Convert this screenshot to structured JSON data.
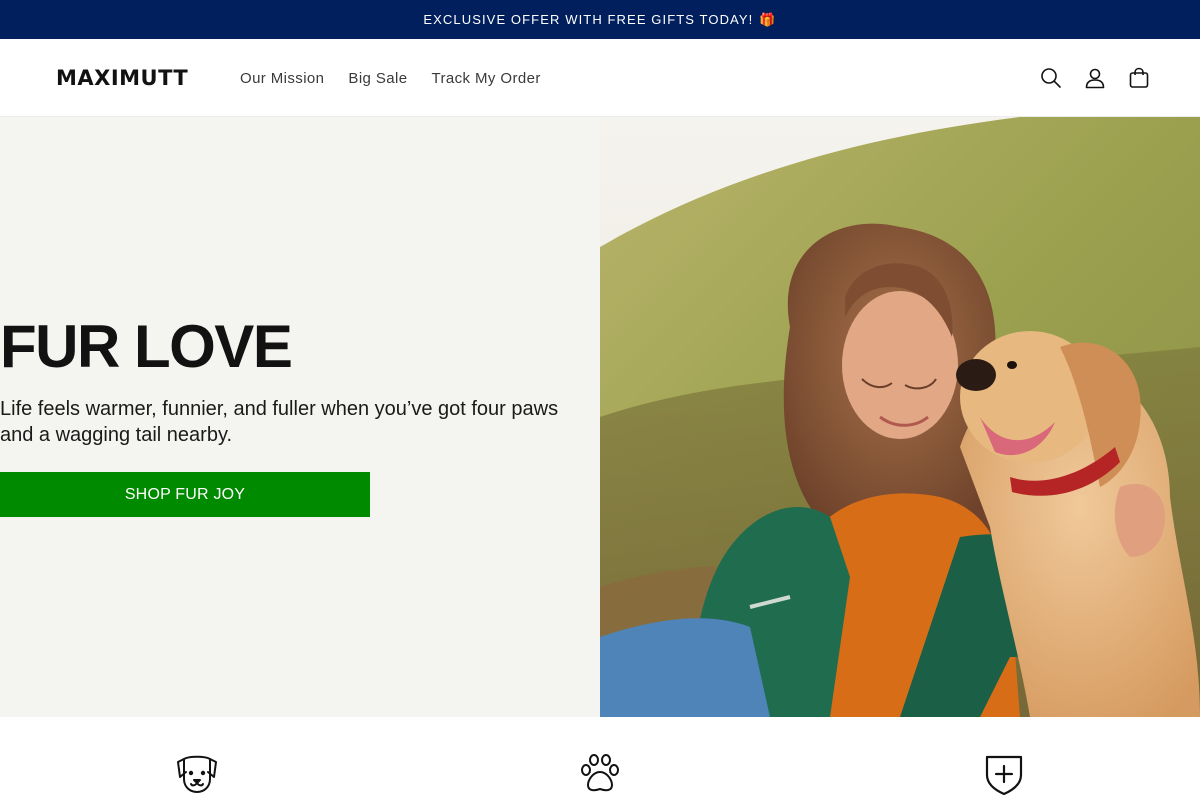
{
  "announcement": {
    "text": "EXCLUSIVE OFFER WITH FREE GIFTS TODAY!",
    "emoji": "🎁"
  },
  "header": {
    "logo": "MAXIMUTT",
    "nav": [
      "Our Mission",
      "Big Sale",
      "Track My Order"
    ],
    "icons": [
      "search-icon",
      "account-icon",
      "cart-icon"
    ]
  },
  "hero": {
    "title": "FUR LOVE",
    "subtitle": "Life feels warmer, funnier, and fuller when you’ve got four paws and a wagging tail nearby.",
    "button": "SHOP FUR JOY"
  },
  "features": {
    "icons": [
      "dog-face-icon",
      "paw-icon",
      "shield-plus-icon"
    ]
  },
  "colors": {
    "announcement_bg": "#001f5c",
    "cta_green": "#008a00",
    "hero_bg": "#f4f4f0"
  }
}
